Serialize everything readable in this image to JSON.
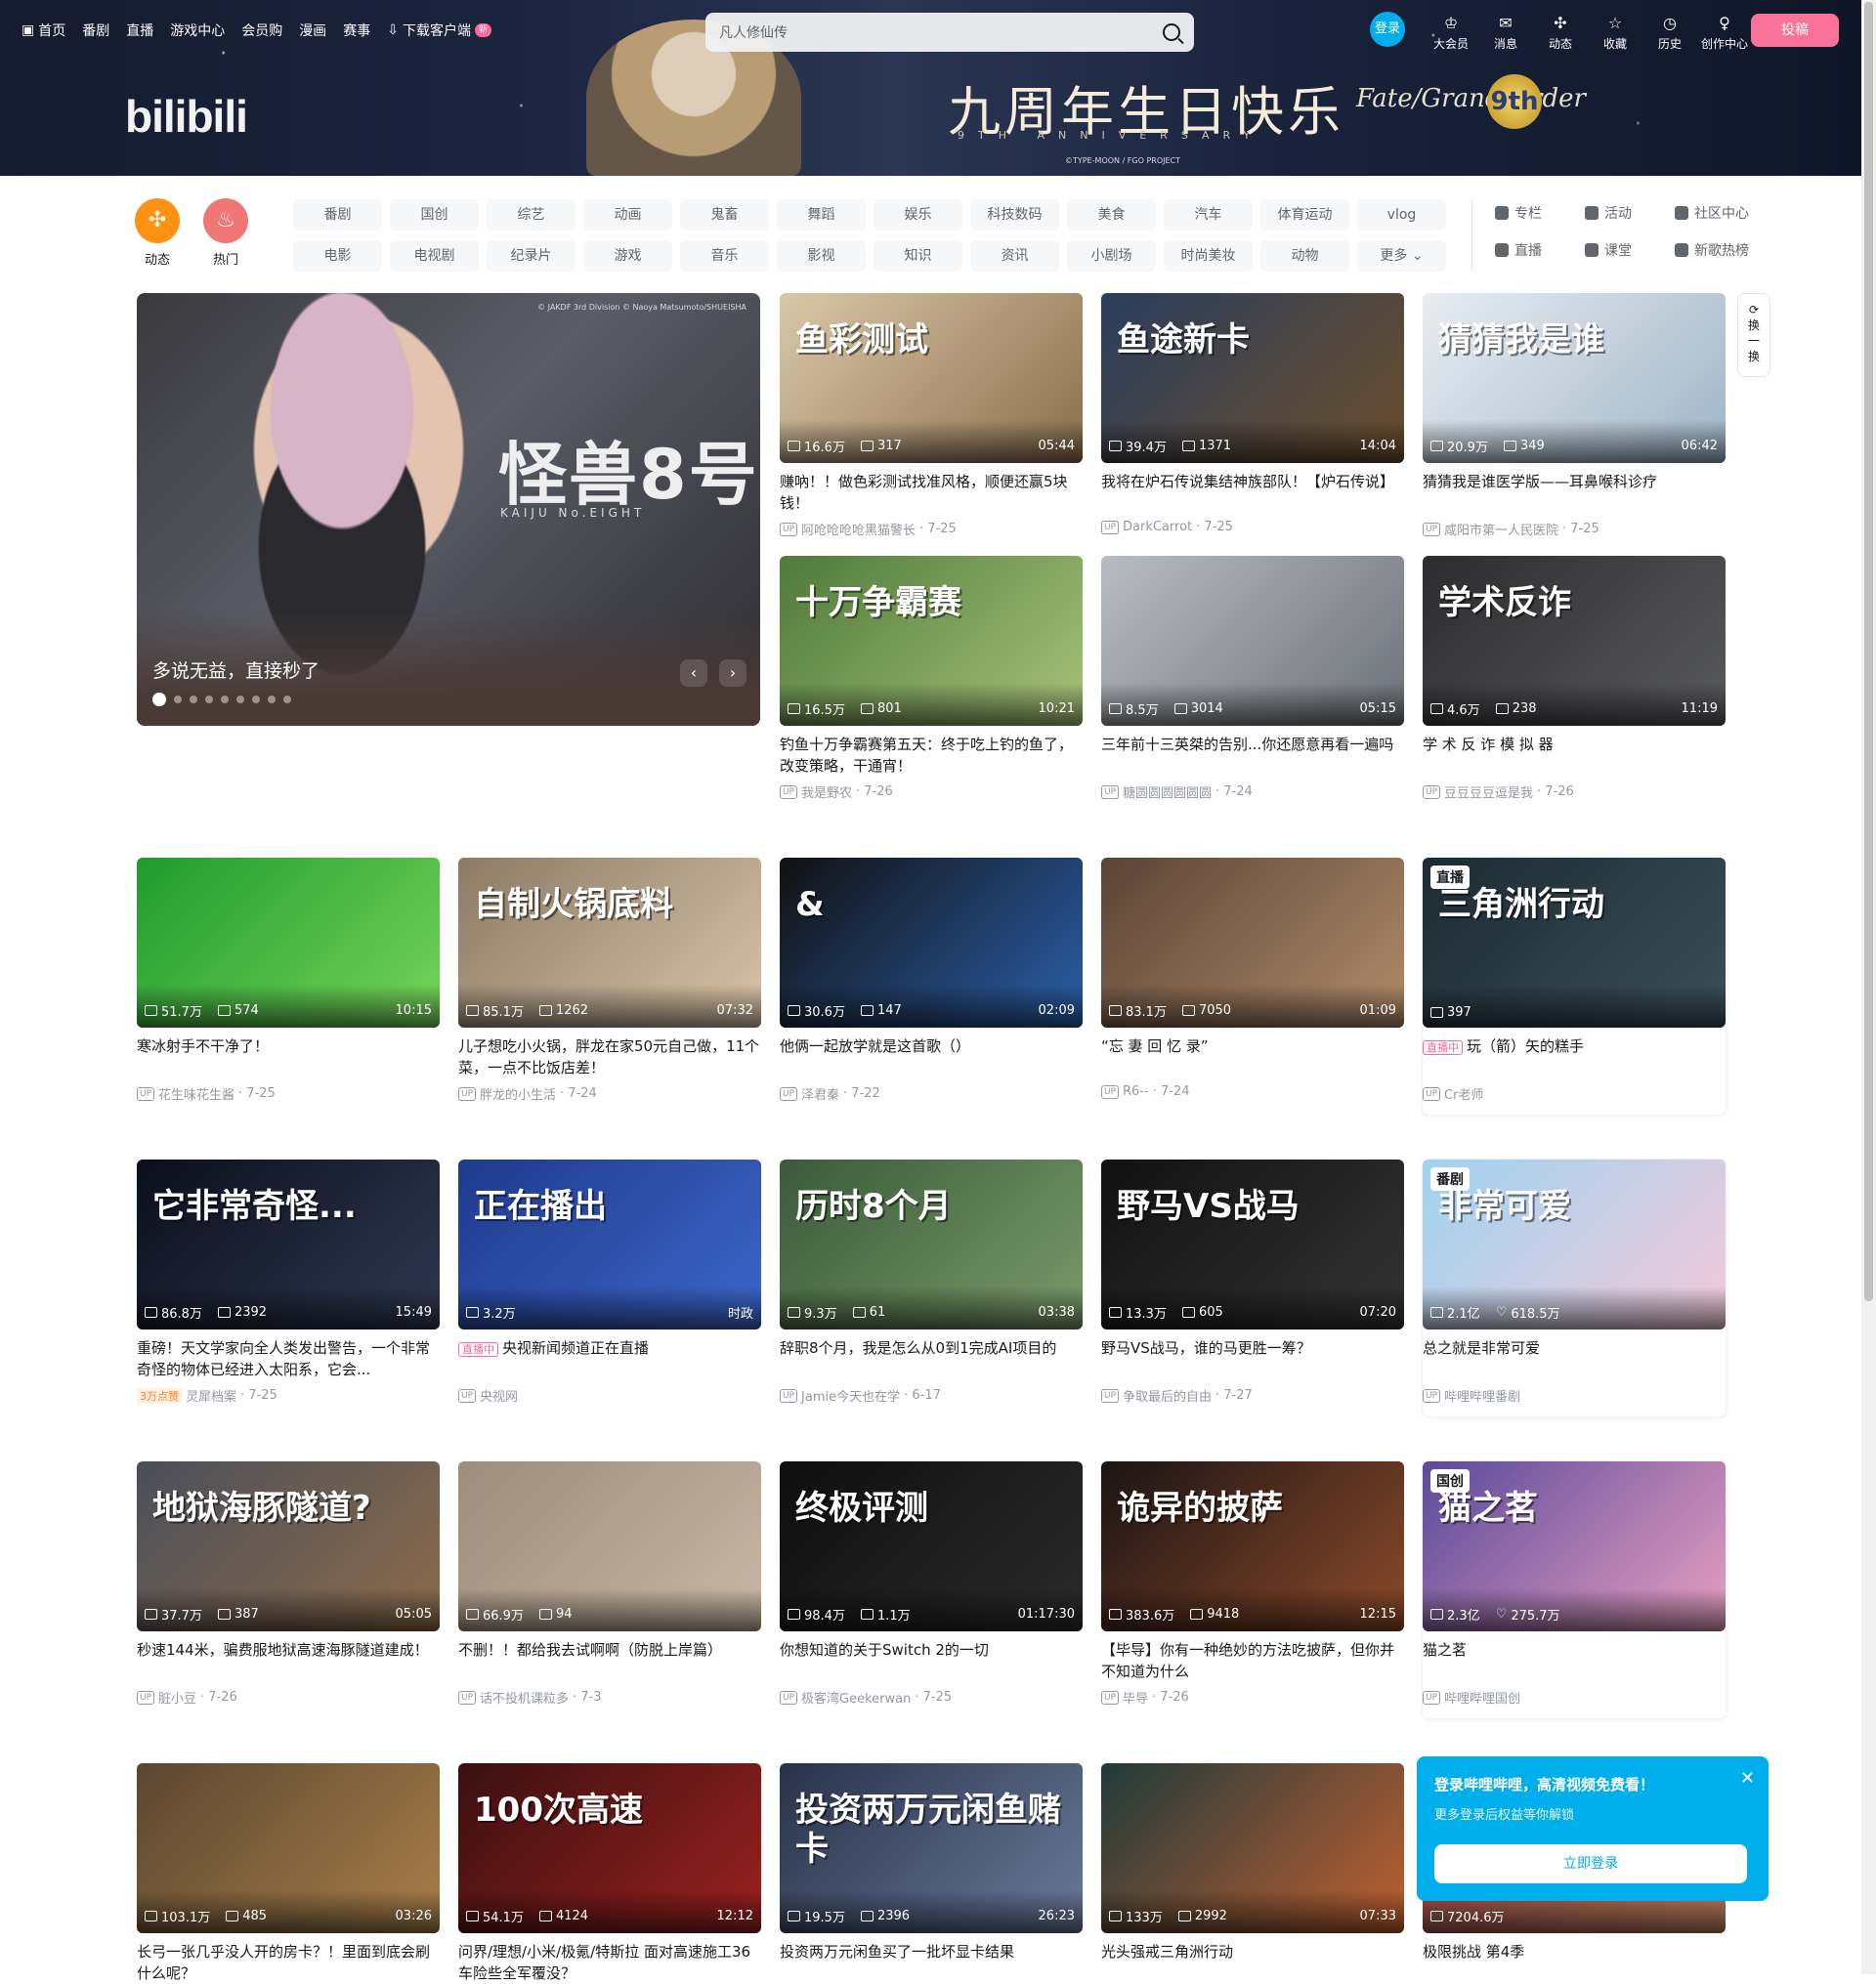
{
  "topnav": [
    {
      "label": "首页",
      "icon": "tv-icon"
    },
    {
      "label": "番剧"
    },
    {
      "label": "直播"
    },
    {
      "label": "游戏中心"
    },
    {
      "label": "会员购"
    },
    {
      "label": "漫画"
    },
    {
      "label": "赛事"
    },
    {
      "label": "下载客户端",
      "icon": "download-icon",
      "badge": "新"
    }
  ],
  "search": {
    "placeholder": "凡人修仙传"
  },
  "banner": {
    "logo": "bilibili",
    "title": "九周年生日快乐",
    "subtitle": "9TH ANNIVERSARY",
    "fgo": "Fate/Grand Order",
    "ninth": "9th",
    "copy": "©TYPE-MOON / FGO PROJECT"
  },
  "usernav": {
    "login": "登录",
    "items": [
      {
        "label": "大会员",
        "icon": "vip-icon"
      },
      {
        "label": "消息",
        "icon": "message-icon"
      },
      {
        "label": "动态",
        "icon": "wind-icon"
      },
      {
        "label": "收藏",
        "icon": "star-icon"
      },
      {
        "label": "历史",
        "icon": "clock-icon"
      },
      {
        "label": "创作中心",
        "icon": "bulb-icon"
      }
    ],
    "upload": "投稿"
  },
  "channels": {
    "left": [
      {
        "label": "动态",
        "color": "#ff9212"
      },
      {
        "label": "热门",
        "color": "#f07775"
      }
    ],
    "chips": [
      "番剧",
      "国创",
      "综艺",
      "动画",
      "鬼畜",
      "舞蹈",
      "娱乐",
      "科技数码",
      "美食",
      "汽车",
      "体育运动",
      "vlog",
      "电影",
      "电视剧",
      "纪录片",
      "游戏",
      "音乐",
      "影视",
      "知识",
      "资讯",
      "小剧场",
      "时尚美妆",
      "动物",
      "更多"
    ],
    "side": [
      "专栏",
      "活动",
      "社区中心",
      "直播",
      "课堂",
      "新歌热榜"
    ]
  },
  "hero": {
    "title": "怪兽8号",
    "subtitle": "KAIJU No.EIGHT",
    "copy": "© JAKDF 3rd Division © Naoya Matsumoto/SHUEISHA",
    "caption": "多说无益，直接秒了",
    "slides": 9,
    "active": 0
  },
  "refresh": {
    "label": "换一换"
  },
  "cards": [
    {
      "title": "赚吶！！做色彩测试找准风格，顺便还赢5块钱！",
      "views": "16.6万",
      "danmaku": "317",
      "duration": "05:44",
      "author": "阿呛呛呛呛黑猫警长",
      "date": "7-25",
      "thumb_text": "鱼彩测试",
      "colors": [
        "#d9c8a8",
        "#8a6e4d"
      ]
    },
    {
      "title": "我将在炉石传说集结神族部队！【炉石传说】",
      "views": "39.4万",
      "danmaku": "1371",
      "duration": "14:04",
      "author": "DarkCarrot",
      "date": "7-25",
      "thumb_text": "鱼途新卡",
      "colors": [
        "#2a3d5c",
        "#6b4f2c"
      ]
    },
    {
      "title": "猜猜我是谁医学版——耳鼻喉科诊疗",
      "views": "20.9万",
      "danmaku": "349",
      "duration": "06:42",
      "author": "咸阳市第一人民医院",
      "date": "7-25",
      "thumb_text": "猜猜我是谁",
      "colors": [
        "#e8edf2",
        "#9fb4c6"
      ]
    },
    {
      "title": "钓鱼十万争霸赛第五天：终于吃上钓的鱼了，改变策略，干通宵！",
      "views": "16.5万",
      "danmaku": "801",
      "duration": "10:21",
      "author": "我是野农",
      "date": "7-26",
      "thumb_text": "十万争霸赛",
      "colors": [
        "#4f7a3b",
        "#a8c27a"
      ]
    },
    {
      "title": "三年前十三英桀的告别...你还愿意再看一遍吗",
      "views": "8.5万",
      "danmaku": "3014",
      "duration": "05:15",
      "author": "糖圆圆圆圆圆圆",
      "date": "7-24",
      "thumb_text": "",
      "colors": [
        "#b9bcc2",
        "#6d7178"
      ]
    },
    {
      "title": "学 术 反 诈 模 拟 器",
      "views": "4.6万",
      "danmaku": "238",
      "duration": "11:19",
      "author": "豆豆豆豆逗是我",
      "date": "7-26",
      "thumb_text": "学术反诈",
      "colors": [
        "#2c2c2e",
        "#595a5e"
      ]
    },
    {
      "title": "寒冰射手不干净了！",
      "views": "51.7万",
      "danmaku": "574",
      "duration": "10:15",
      "author": "花生味花生酱",
      "date": "7-25",
      "thumb_text": "",
      "colors": [
        "#1f9b2e",
        "#77d35a"
      ]
    },
    {
      "title": "儿子想吃小火锅，胖龙在家50元自己做，11个菜，一点不比饭店差！",
      "views": "85.1万",
      "danmaku": "1262",
      "duration": "07:32",
      "author": "胖龙的小生活",
      "date": "7-24",
      "thumb_text": "自制火锅底料",
      "colors": [
        "#8c7a66",
        "#d8c4a8"
      ]
    },
    {
      "title": "他俩一起放学就是这首歌（）",
      "views": "30.6万",
      "danmaku": "147",
      "duration": "02:09",
      "author": "泽君秦",
      "date": "7-22",
      "thumb_text": "&",
      "colors": [
        "#111",
        "#2a5fa8"
      ]
    },
    {
      "title": "“忘 妻 回 忆 录”",
      "views": "83.1万",
      "danmaku": "7050",
      "duration": "01:09",
      "author": "R6--",
      "date": "7-24",
      "thumb_text": "",
      "colors": [
        "#5a4436",
        "#b08b6a"
      ]
    },
    {
      "title": "玩（箭）矢的糕手",
      "live": "直播中",
      "views": "397",
      "author": "Cr老师",
      "tag": "直播",
      "thumb_text": "三角洲行动",
      "colors": [
        "#1c2a33",
        "#3b4f58"
      ]
    },
    {
      "title": "重磅！天文学家向全人类发出警告，一个非常奇怪的物体已经进入太阳系，它会...",
      "views": "86.8万",
      "danmaku": "2392",
      "duration": "15:49",
      "author": "灵犀档案",
      "date": "7-25",
      "likes": "3万点赞",
      "thumb_text": "它非常奇怪...",
      "colors": [
        "#0b0f1c",
        "#2f3850"
      ]
    },
    {
      "title": "央视新闻频道正在直播",
      "live": "直播中",
      "views": "3.2万",
      "duration": "时政",
      "author": "央视网",
      "thumb_text": "正在播出",
      "colors": [
        "#1f3a8c",
        "#3c66c9"
      ]
    },
    {
      "title": "辞职8个月，我是怎么从0到1完成AI项目的",
      "views": "9.3万",
      "danmaku": "61",
      "duration": "03:38",
      "author": "Jamie今天也在学",
      "date": "6-17",
      "thumb_text": "历时8个月",
      "colors": [
        "#3a5a3a",
        "#7a9a6a"
      ]
    },
    {
      "title": "野马VS战马，谁的马更胜一筹？",
      "views": "13.3万",
      "danmaku": "605",
      "duration": "07:20",
      "author": "争取最后的自由",
      "date": "7-27",
      "thumb_text": "野马VS战马",
      "colors": [
        "#111",
        "#333"
      ]
    },
    {
      "title": "总之就是非常可爱",
      "views": "2.1亿",
      "likes_count": "618.5万",
      "author": "哔哩哔哩番剧",
      "tag": "番剧",
      "thumb_text": "非常可爱",
      "colors": [
        "#9fd3f0",
        "#f2c9d8"
      ]
    },
    {
      "title": "秒速144米，骗费服地狱高速海豚隧道建成！",
      "views": "37.7万",
      "danmaku": "387",
      "duration": "05:05",
      "author": "脏小豆",
      "date": "7-26",
      "thumb_text": "地狱海豚隧道?",
      "colors": [
        "#4b4f5a",
        "#8b6b4a"
      ]
    },
    {
      "title": "不删！！都给我去试啊啊（防脱上岸篇）",
      "views": "66.9万",
      "danmaku": "94",
      "duration": "",
      "author": "话不投机课粒多",
      "date": "7-3",
      "thumb_text": "",
      "colors": [
        "#9d8b7b",
        "#c9b8a6"
      ]
    },
    {
      "title": "你想知道的关于Switch 2的一切",
      "views": "98.4万",
      "danmaku": "1.1万",
      "duration": "01:17:30",
      "author": "极客湾Geekerwan",
      "date": "7-25",
      "thumb_text": "终极评测",
      "colors": [
        "#0e0e0e",
        "#2b2b2b"
      ]
    },
    {
      "title": "【毕导】你有一种绝妙的方法吃披萨，但你并不知道为什么",
      "views": "383.6万",
      "danmaku": "9418",
      "duration": "12:15",
      "author": "毕导",
      "date": "7-26",
      "thumb_text": "诡异的披萨",
      "colors": [
        "#1a1414",
        "#8c4a2a"
      ]
    },
    {
      "title": "猫之茗",
      "views": "2.3亿",
      "likes_count": "275.7万",
      "author": "哔哩哔哩国创",
      "tag": "国创",
      "thumb_text": "猫之茗",
      "colors": [
        "#5a4a9a",
        "#e8a0c0"
      ]
    },
    {
      "title": "长弓一张几乎没人开的房卡？！里面到底会刷什么呢？",
      "views": "103.1万",
      "danmaku": "485",
      "duration": "03:26",
      "author": "",
      "date": "",
      "thumb_text": "",
      "colors": [
        "#5a4630",
        "#a87f4a"
      ]
    },
    {
      "title": "问界/理想/小米/极氪/特斯拉 面对高速施工36车险些全军覆没？",
      "views": "54.1万",
      "danmaku": "4124",
      "duration": "12:12",
      "author": "",
      "date": "",
      "thumb_text": "100次高速",
      "colors": [
        "#3a1010",
        "#9a2020"
      ]
    },
    {
      "title": "投资两万元闲鱼买了一批坏显卡结果",
      "views": "19.5万",
      "danmaku": "2396",
      "duration": "26:23",
      "author": "",
      "date": "",
      "thumb_text": "投资两万元闲鱼赌卡",
      "colors": [
        "#28324a",
        "#6a7a9a"
      ]
    },
    {
      "title": "光头强戒三角洲行动",
      "views": "133万",
      "danmaku": "2992",
      "duration": "07:33",
      "author": "",
      "date": "",
      "thumb_text": "",
      "colors": [
        "#203a3a",
        "#c06030"
      ]
    },
    {
      "title": "极限挑战 第4季",
      "views": "7204.6万",
      "danmaku": "",
      "duration": "",
      "author": "",
      "date": "",
      "thumb_text": "",
      "colors": [
        "#8a3a3a",
        "#c08060"
      ]
    }
  ],
  "popup": {
    "title": "登录哔哩哔哩，高清视频免费看！",
    "desc": "更多登录后权益等你解锁",
    "button": "立即登录"
  }
}
